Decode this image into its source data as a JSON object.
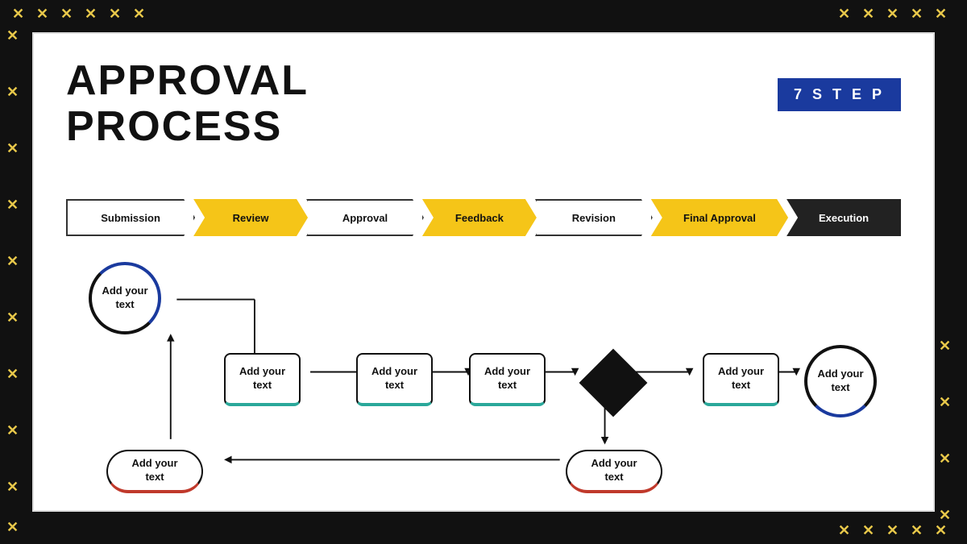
{
  "title": {
    "line1": "APPROVAL",
    "line2": "PROCESS"
  },
  "badge": {
    "label": "7  S T E P"
  },
  "steps": [
    {
      "id": "submission",
      "label": "Submission",
      "style": "white-step first"
    },
    {
      "id": "review",
      "label": "Review",
      "style": "yellow-step"
    },
    {
      "id": "approval",
      "label": "Approval",
      "style": "white-step"
    },
    {
      "id": "feedback",
      "label": "Feedback",
      "style": "yellow-step"
    },
    {
      "id": "revision",
      "label": "Revision",
      "style": "white-step"
    },
    {
      "id": "final-approval",
      "label": "Final Approval",
      "style": "yellow-step"
    },
    {
      "id": "execution",
      "label": "Execution",
      "style": "dark-step"
    }
  ],
  "shapes": {
    "circle1": {
      "label": "Add your\ntext"
    },
    "rect1": {
      "label": "Add your\ntext"
    },
    "rect2": {
      "label": "Add your\ntext"
    },
    "rect3": {
      "label": "Add your\ntext"
    },
    "diamond": {
      "label": ""
    },
    "rect4": {
      "label": "Add your\ntext"
    },
    "circle2": {
      "label": "Add your\ntext"
    },
    "oval1": {
      "label": "Add your\ntext"
    },
    "oval2": {
      "label": "Add your\ntext"
    }
  },
  "deco": {
    "border_color": "#111",
    "accent_color": "#e8c84a"
  }
}
